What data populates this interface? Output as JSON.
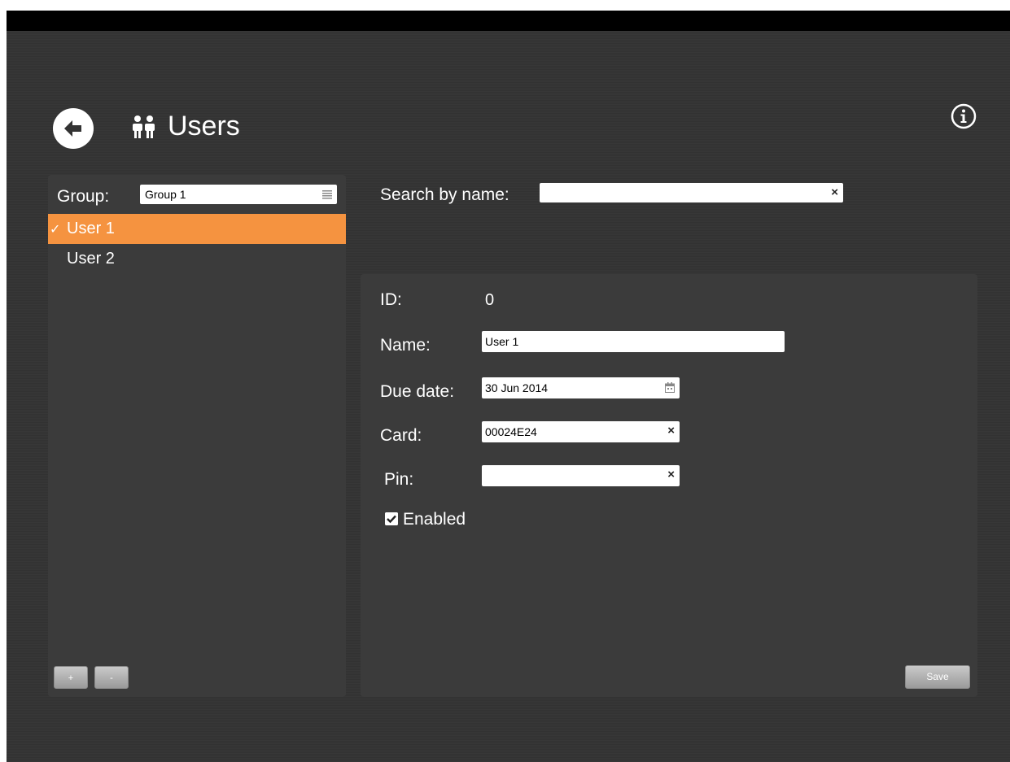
{
  "header": {
    "title": "Users",
    "back_icon": "back-arrow-icon",
    "people_icon": "users-icon",
    "info_icon": "info-icon"
  },
  "group": {
    "label": "Group:",
    "selected": "Group 1"
  },
  "users": [
    {
      "name": "User 1",
      "selected": true
    },
    {
      "name": "User 2",
      "selected": false
    }
  ],
  "list_buttons": {
    "add": "+",
    "remove": "-"
  },
  "search": {
    "label": "Search by name:",
    "value": "",
    "clear": "×"
  },
  "detail": {
    "id_label": "ID:",
    "id_value": "0",
    "name_label": "Name:",
    "name_value": "User 1",
    "due_label": "Due date:",
    "due_value": "30 Jun 2014",
    "card_label": "Card:",
    "card_value": "00024E24",
    "pin_label": "Pin:",
    "pin_value": "",
    "enabled_label": "Enabled",
    "enabled": true,
    "save_label": "Save",
    "clear": "×"
  },
  "colors": {
    "accent": "#f59340",
    "background": "#333333",
    "panel": "#3b3b3b"
  }
}
